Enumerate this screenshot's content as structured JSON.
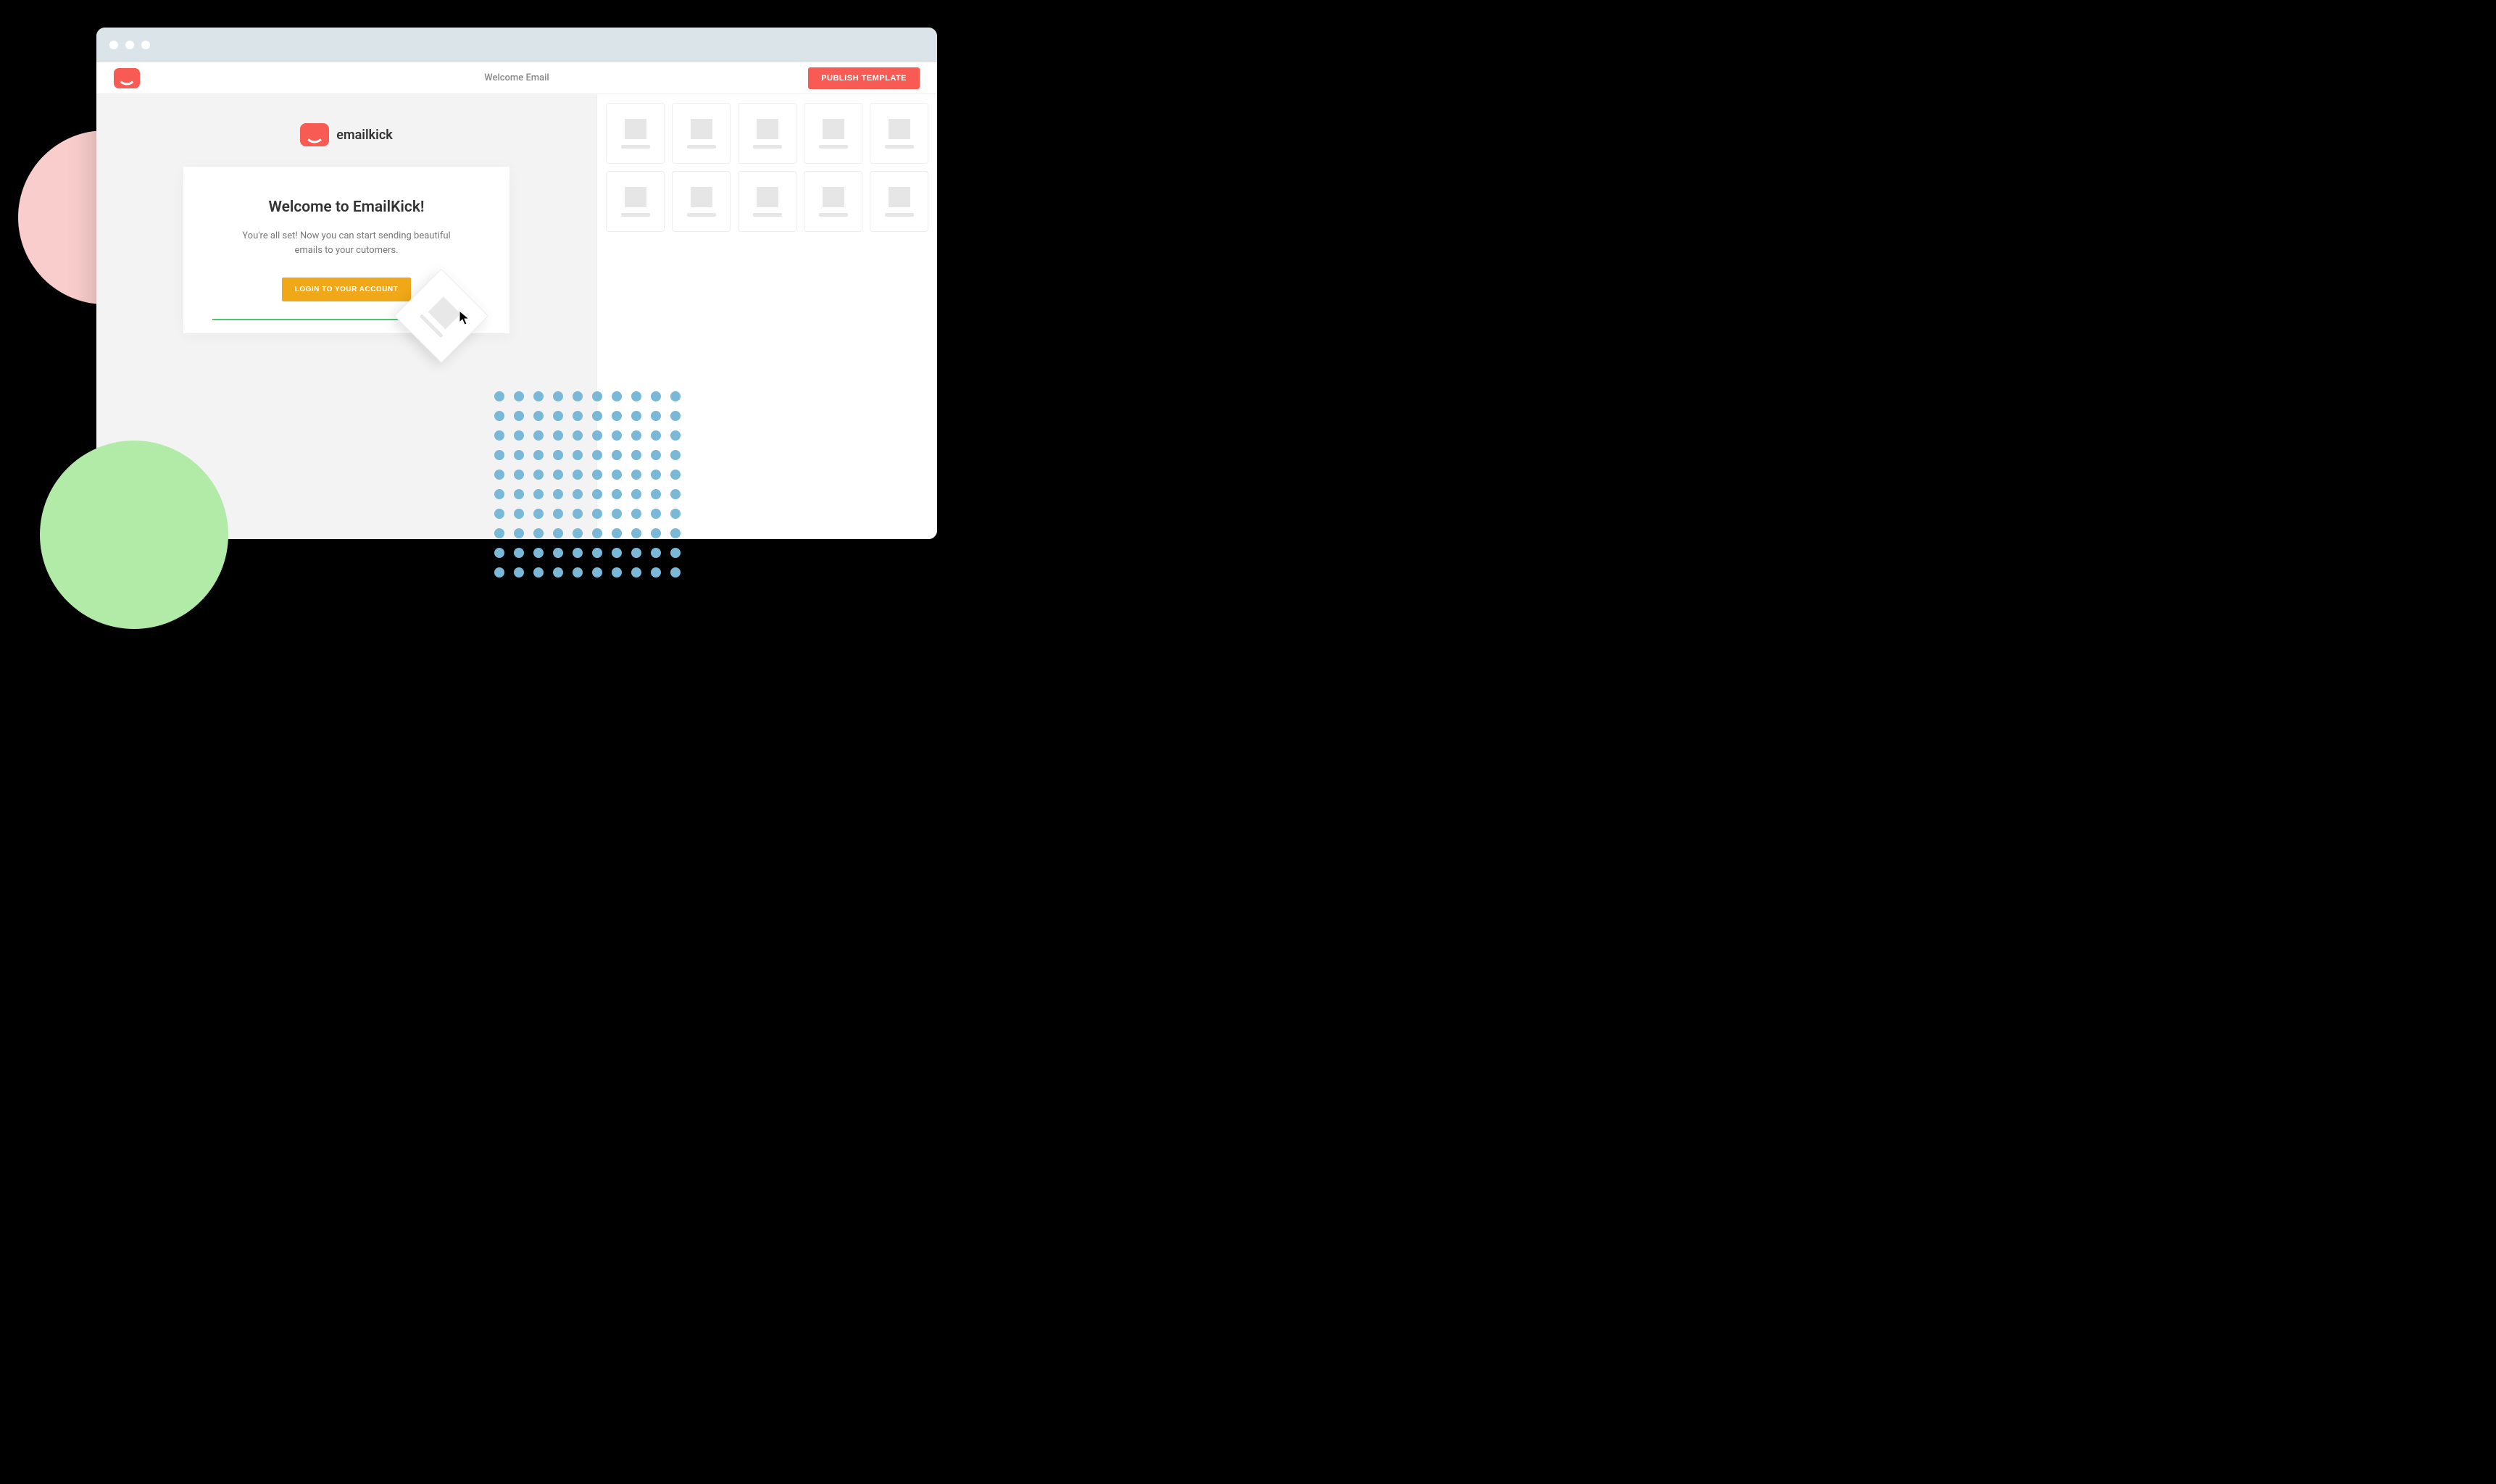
{
  "header": {
    "title": "Welcome Email",
    "publish_label": "PUBLISH TEMPLATE"
  },
  "brand": {
    "name": "emailkick"
  },
  "email": {
    "heading": "Welcome to EmailKick!",
    "subtext": "You're all set! Now you can start sending beautiful emails to your cutomers.",
    "cta_label": "LOGIN TO YOUR ACCOUNT"
  },
  "colors": {
    "accent": "#f75b53",
    "cta": "#f0a818",
    "drop_indicator": "#4cc96b"
  }
}
